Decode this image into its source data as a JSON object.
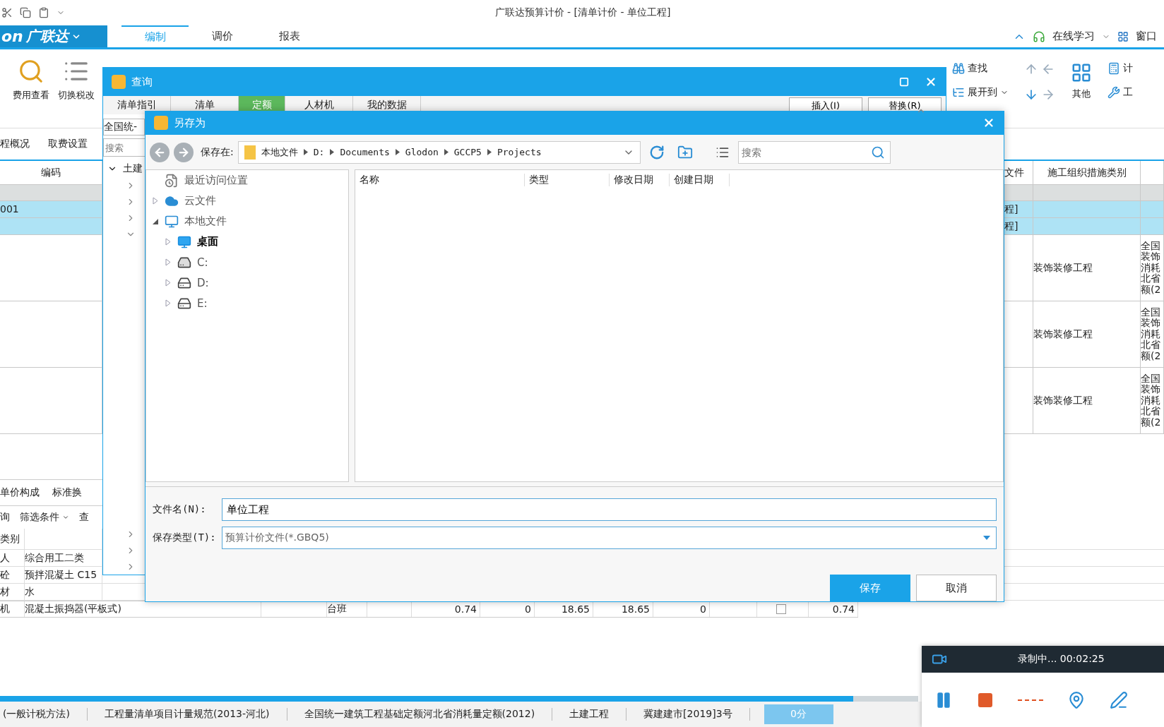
{
  "window": {
    "title": "广联达预算计价 - [清单计价 - 单位工程]"
  },
  "menu": {
    "logo_mark": "on",
    "logo": "广联达",
    "tabs": [
      {
        "label": "编制",
        "selected": true
      },
      {
        "label": "调价",
        "selected": false
      },
      {
        "label": "报表",
        "selected": false
      }
    ],
    "learn": "在线学习",
    "window_menu": "窗口"
  },
  "ribbon": {
    "left": [
      "费用查看",
      "切换税改"
    ],
    "find": "查找",
    "expand": "展开到",
    "other": "其他",
    "cut_right": [
      "计",
      "工"
    ]
  },
  "view_tabs": [
    "程概况",
    "取费设置"
  ],
  "table": {
    "columns": [
      "编码",
      "文件",
      "施工组织措施类别"
    ],
    "rows": [
      {
        "kind": "blank"
      },
      {
        "kind": "section",
        "code": "001",
        "file": "程]"
      },
      {
        "kind": "section",
        "file": "程]"
      },
      {
        "kind": "item",
        "category": "装饰装修工程",
        "column_4": "全国装饰消耗北省额(2"
      },
      {
        "kind": "item",
        "category": "装饰装修工程",
        "column_4": "全国装饰消耗北省额(2"
      },
      {
        "kind": "item",
        "category": "装饰装修工程",
        "column_4": "全国装饰消耗北省额(2"
      }
    ]
  },
  "detail": {
    "tabs": [
      "单价构成",
      "标准换"
    ],
    "toolbar": [
      {
        "kind": "button",
        "label": "询"
      },
      {
        "kind": "menu",
        "label": "筛选条件"
      },
      {
        "kind": "button",
        "label": "查"
      }
    ],
    "header": "类别",
    "rows": [
      {
        "type": "人",
        "name": "综合用工二类"
      },
      {
        "type": "砼",
        "name": "预拌混凝土 C15"
      },
      {
        "type": "材",
        "name": "水"
      },
      {
        "type": "机",
        "name": "混凝土振捣器(平板式)",
        "unit": "台班",
        "values": [
          "0.74",
          "0",
          "18.65",
          "18.65",
          "0"
        ],
        "checked": false,
        "total": "0.74"
      }
    ]
  },
  "status_bar": {
    "items": [
      "(一般计税方法)",
      "工程量清单项目计量规范(2013-河北)",
      "全国统一建筑工程基础定额河北省消耗量定额(2012)",
      "土建工程",
      "冀建建市[2019]3号"
    ],
    "score": "0分"
  },
  "recorder": {
    "status": "录制中... 00:02:25"
  },
  "query_dialog": {
    "title": "查询",
    "tabs": [
      {
        "label": "清单指引",
        "selected": false
      },
      {
        "label": "清单",
        "selected": false
      },
      {
        "label": "定额",
        "selected": true
      },
      {
        "label": "人材机",
        "selected": false
      },
      {
        "label": "我的数据",
        "selected": false
      }
    ],
    "buttons": [
      "插入(I)",
      "替换(R)"
    ],
    "library": "全国统-",
    "search_placeholder": "搜索",
    "tree": [
      {
        "label": "土建",
        "expanded": true
      }
    ]
  },
  "save_as": {
    "title": "另存为",
    "location_label": "保存在:",
    "path": [
      "本地文件",
      "D:",
      "Documents",
      "Glodon",
      "GCCP5",
      "Projects"
    ],
    "search_placeholder": "搜索",
    "nav": [
      {
        "kind": "recent",
        "label": "最近访问位置",
        "selected": false
      },
      {
        "kind": "cloud",
        "label": "云文件",
        "expanded": false,
        "selected": false
      },
      {
        "kind": "computer",
        "label": "本地文件",
        "expanded": true,
        "selected": false,
        "children": [
          {
            "kind": "desktop",
            "label": "桌面",
            "expanded": false,
            "selected": true
          },
          {
            "kind": "system_drive",
            "label": "C:",
            "expanded": false,
            "selected": false
          },
          {
            "kind": "drive",
            "label": "D:",
            "expanded": false,
            "selected": false
          },
          {
            "kind": "drive",
            "label": "E:",
            "expanded": false,
            "selected": false
          }
        ]
      }
    ],
    "columns": [
      "名称",
      "类型",
      "修改日期",
      "创建日期"
    ],
    "file_name": {
      "label": "文件名(N):",
      "value": "单位工程"
    },
    "file_type": {
      "label": "保存类型(T):",
      "value": "预算计价文件(*.GBQ5)"
    },
    "buttons": [
      {
        "label": "保存",
        "kind": "primary"
      },
      {
        "label": "取消",
        "kind": "secondary"
      }
    ]
  }
}
